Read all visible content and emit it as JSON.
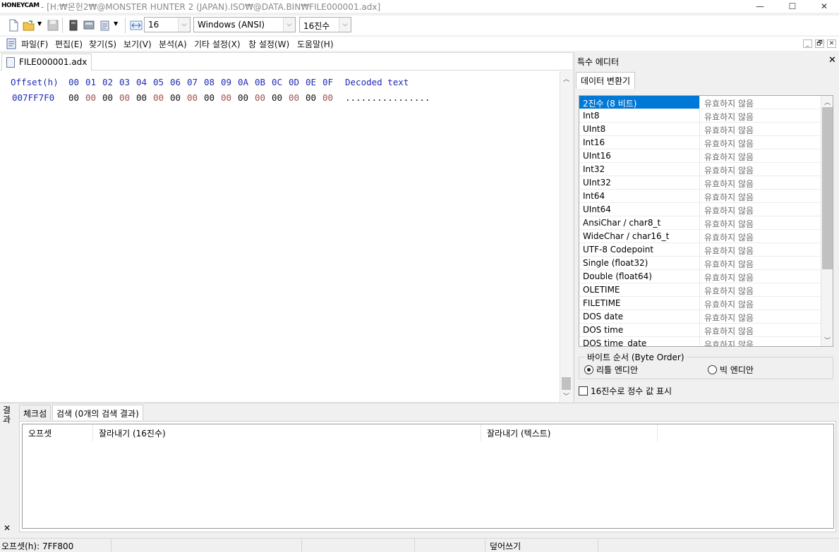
{
  "app": {
    "logo": "HONEYCAM",
    "window_title": "- [H:₩몬헌2₩@MONSTER HUNTER 2 (JAPAN).ISO₩@DATA.BIN₩FILE000001.adx]",
    "window_controls": {
      "minimize": "—",
      "maximize": "☐",
      "close": "✕"
    }
  },
  "toolbar": {
    "bytes_per_row": "16",
    "charset": "Windows (ANSI)",
    "number_base": "16진수",
    "dropdown_arrow": "⌵"
  },
  "menu": {
    "items": [
      "파일(F)",
      "편집(E)",
      "찾기(S)",
      "보기(V)",
      "분석(A)",
      "기타 설정(X)",
      "창 설정(W)",
      "도움말(H)"
    ],
    "mdi_controls": [
      "_",
      "🗗",
      "✕"
    ]
  },
  "editor": {
    "tab_label": "FILE000001.adx",
    "header": {
      "offset_label": "Offset(h)",
      "columns": [
        "00",
        "01",
        "02",
        "03",
        "04",
        "05",
        "06",
        "07",
        "08",
        "09",
        "0A",
        "0B",
        "0C",
        "0D",
        "0E",
        "0F"
      ],
      "decoded_label": "Decoded text"
    },
    "rows": [
      {
        "offset": "007FF7F0",
        "bytes": [
          "00",
          "00",
          "00",
          "00",
          "00",
          "00",
          "00",
          "00",
          "00",
          "00",
          "00",
          "00",
          "00",
          "00",
          "00",
          "00"
        ],
        "decoded": "................"
      }
    ],
    "scroll_up": "︿",
    "scroll_down": "﹀"
  },
  "special_editor": {
    "title": "특수 에디터",
    "close": "✕",
    "tab": "데이터 변환기",
    "rows": [
      {
        "name": "2진수 (8 비트)",
        "value": "유효하지 않음",
        "selected": true
      },
      {
        "name": "Int8",
        "value": "유효하지 않음"
      },
      {
        "name": "UInt8",
        "value": "유효하지 않음"
      },
      {
        "name": "Int16",
        "value": "유효하지 않음"
      },
      {
        "name": "UInt16",
        "value": "유효하지 않음"
      },
      {
        "name": "Int32",
        "value": "유효하지 않음"
      },
      {
        "name": "UInt32",
        "value": "유효하지 않음"
      },
      {
        "name": "Int64",
        "value": "유효하지 않음"
      },
      {
        "name": "UInt64",
        "value": "유효하지 않음"
      },
      {
        "name": "AnsiChar / char8_t",
        "value": "유효하지 않음"
      },
      {
        "name": "WideChar / char16_t",
        "value": "유효하지 않음"
      },
      {
        "name": "UTF-8 Codepoint",
        "value": "유효하지 않음"
      },
      {
        "name": "Single (float32)",
        "value": "유효하지 않음"
      },
      {
        "name": "Double (float64)",
        "value": "유효하지 않음"
      },
      {
        "name": "OLETIME",
        "value": "유효하지 않음"
      },
      {
        "name": "FILETIME",
        "value": "유효하지 않음"
      },
      {
        "name": "DOS date",
        "value": "유효하지 않음"
      },
      {
        "name": "DOS time",
        "value": "유효하지 않음"
      },
      {
        "name": "DOS time_date",
        "value": "유효하지 않음"
      }
    ],
    "byte_order": {
      "legend": "바이트 순서 (Byte Order)",
      "little": "리틀 엔디안",
      "big": "빅 엔디안",
      "selected": "little"
    },
    "hex_int_checkbox": "16진수로 정수 값 표시",
    "hex_int_checked": false
  },
  "results": {
    "side_label": "결과",
    "side_close": "✕",
    "tabs": [
      "체크섬",
      "검색 (0개의 검색 결과)"
    ],
    "active_tab": 1,
    "columns": [
      "오프셋",
      "잘라내기 (16진수)",
      "잘라내기 (텍스트)"
    ]
  },
  "status": {
    "offset": "오프셋(h): 7FF800",
    "mode": "덮어쓰기"
  },
  "colors": {
    "header_blue": "#1e2ab6",
    "zero_dark": "#111111",
    "zero_red": "#a05050",
    "selection": "#0078d7"
  }
}
